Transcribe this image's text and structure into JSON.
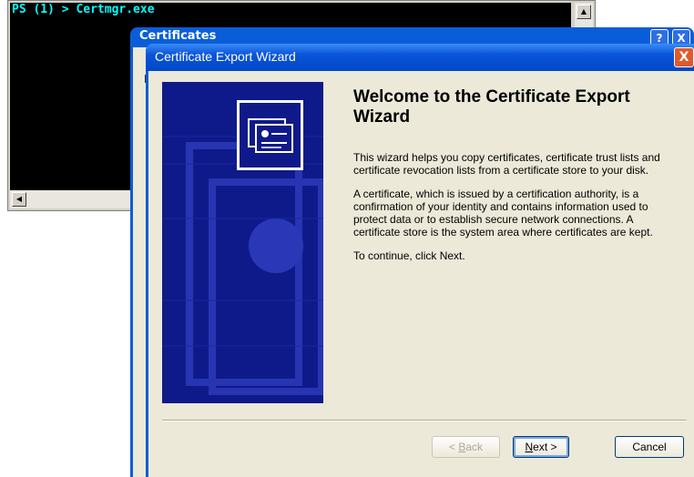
{
  "console": {
    "prompt_line": "PS (1) > Certmgr.exe"
  },
  "certificates_window": {
    "title": "Certificates",
    "help_label": "?",
    "close_label": "X",
    "peek_char": "I"
  },
  "wizard": {
    "title": "Certificate Export Wizard",
    "close_label": "X",
    "heading": "Welcome to the Certificate Export Wizard",
    "paragraph1": "This wizard helps you copy certificates, certificate trust lists and certificate revocation lists from a certificate store to your disk.",
    "paragraph2": "A certificate, which is issued by a certification authority, is a confirmation of your identity and contains information used to protect data or to establish secure network connections. A certificate store is the system area where certificates are kept.",
    "paragraph3": "To continue, click Next.",
    "buttons": {
      "back_prefix": "< ",
      "back_access": "B",
      "back_rest": "ack",
      "next_access": "N",
      "next_rest": "ext >",
      "cancel": "Cancel"
    }
  },
  "colors": {
    "title_bar": "#0a5dd9",
    "banner": "#0f1a8a",
    "console_text": "#00ffff"
  }
}
